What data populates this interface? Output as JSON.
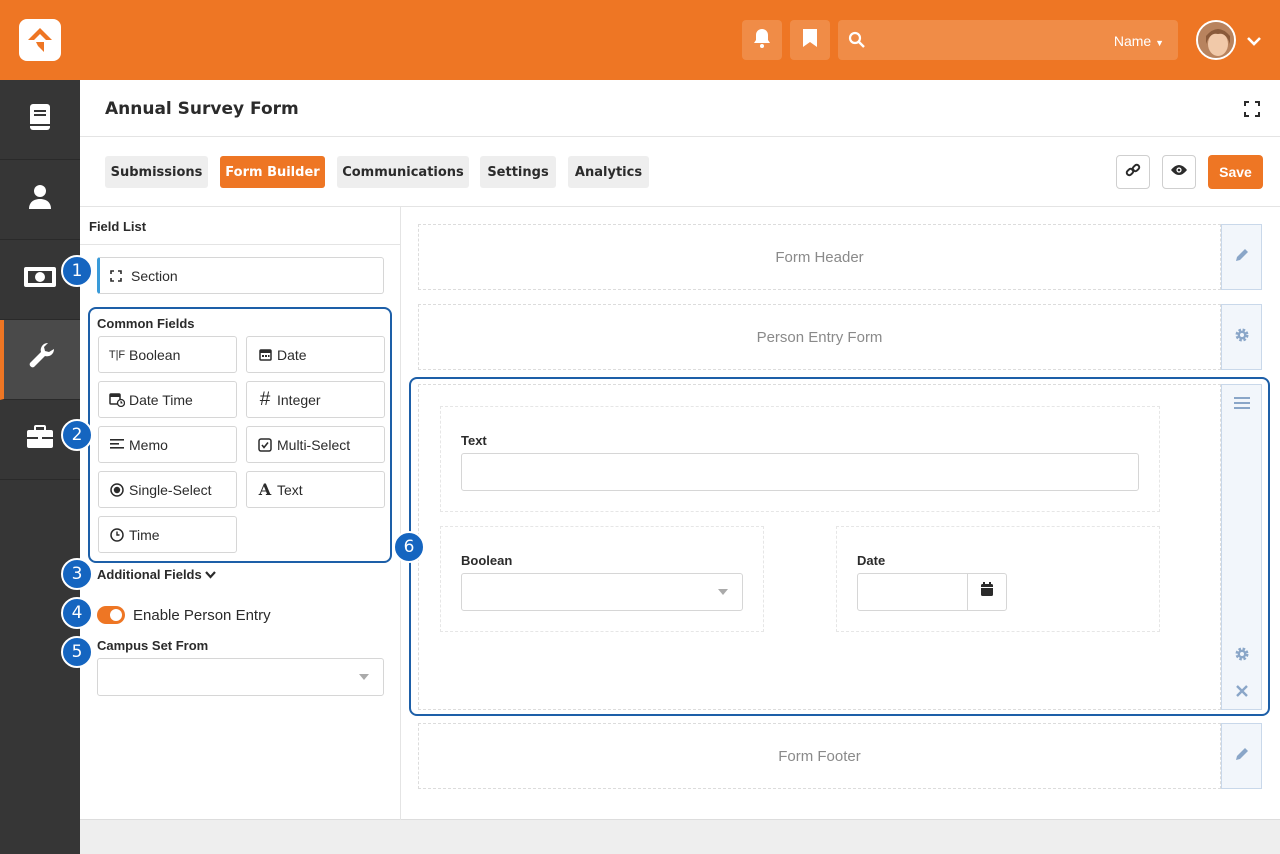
{
  "header": {
    "search_name_label": "Name",
    "icons": [
      "bell-icon",
      "bookmark-icon",
      "search-icon",
      "chevron-down-icon"
    ],
    "brand_color": "#ee7624"
  },
  "sidebar": {
    "items": [
      "book-icon",
      "person-icon",
      "money-icon",
      "wrench-icon",
      "briefcase-icon"
    ],
    "active_index": 3
  },
  "page": {
    "title": "Annual Survey Form"
  },
  "tabs": [
    {
      "label": "Submissions",
      "active": false
    },
    {
      "label": "Form Builder",
      "active": true
    },
    {
      "label": "Communications",
      "active": false
    },
    {
      "label": "Settings",
      "active": false
    },
    {
      "label": "Analytics",
      "active": false
    }
  ],
  "toolbar": {
    "save_label": "Save"
  },
  "field_list": {
    "title": "Field List",
    "section_label": "Section",
    "common_fields_label": "Common Fields",
    "common_fields": [
      {
        "label": "Boolean",
        "icon": "T|F"
      },
      {
        "label": "Date",
        "icon": "calendar-icon"
      },
      {
        "label": "Date Time",
        "icon": "calendar-clock-icon"
      },
      {
        "label": "Integer",
        "icon": "#"
      },
      {
        "label": "Memo",
        "icon": "align-left-icon"
      },
      {
        "label": "Multi-Select",
        "icon": "checkbox-icon"
      },
      {
        "label": "Single-Select",
        "icon": "radio-icon"
      },
      {
        "label": "Text",
        "icon": "A"
      },
      {
        "label": "Time",
        "icon": "clock-icon"
      }
    ],
    "additional_fields_label": "Additional Fields",
    "enable_person_entry_label": "Enable Person Entry",
    "campus_set_from_label": "Campus Set From"
  },
  "callouts": [
    "1",
    "2",
    "3",
    "4",
    "5",
    "6"
  ],
  "canvas": {
    "form_header": "Form Header",
    "person_entry_form": "Person Entry Form",
    "text_label": "Text",
    "boolean_label": "Boolean",
    "date_label": "Date",
    "form_footer": "Form Footer"
  },
  "callout_color": "#1565c0"
}
